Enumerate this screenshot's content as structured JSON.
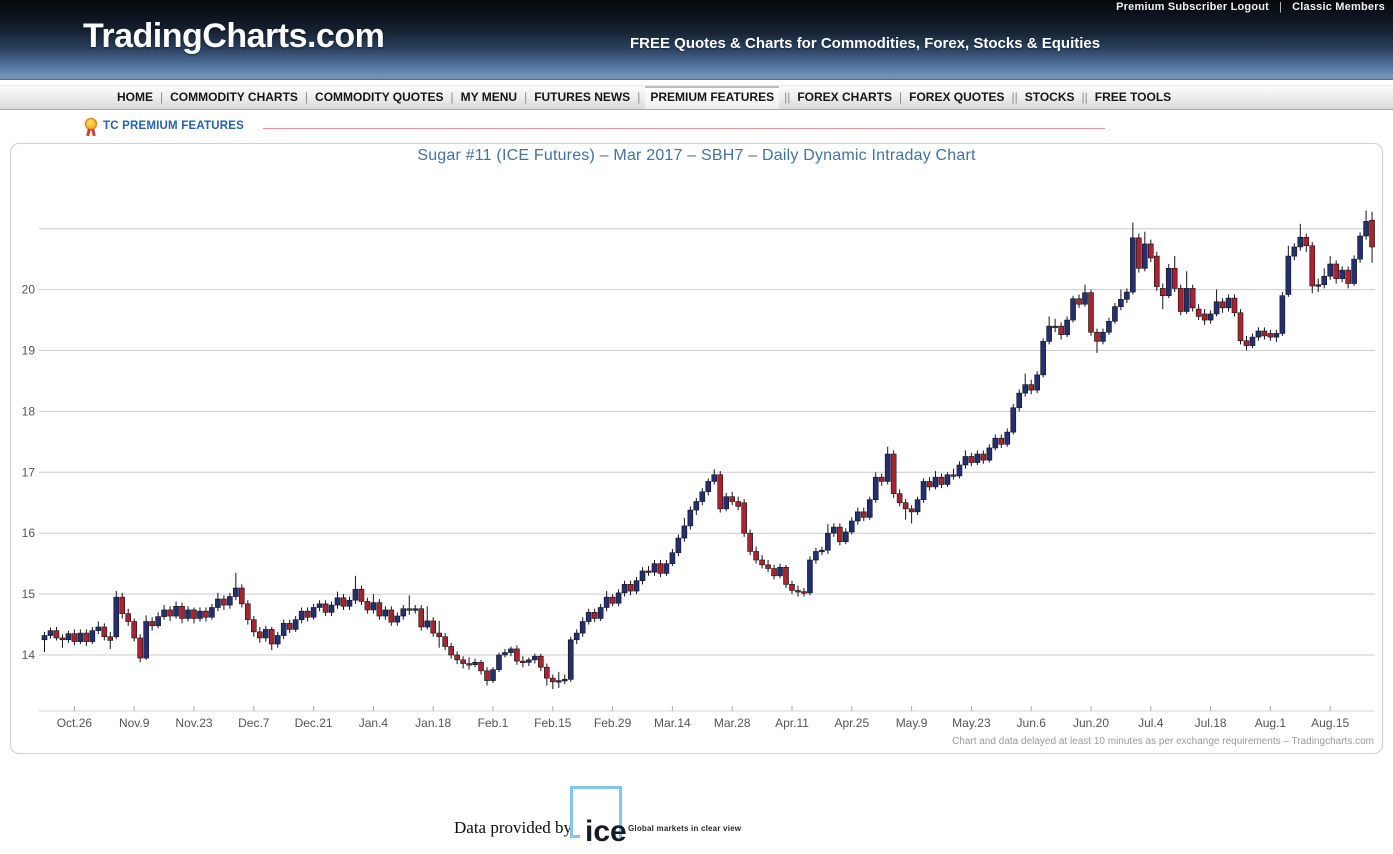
{
  "top_bar": {
    "links": [
      "Premium Subscriber Logout",
      "Classic Members"
    ],
    "separator": "|"
  },
  "header": {
    "logo": "TradingCharts.com",
    "tagline": "FREE Quotes & Charts for Commodities, Forex, Stocks & Equities"
  },
  "nav": {
    "items": [
      {
        "label": "HOME",
        "sep": "|",
        "active": false
      },
      {
        "label": "COMMODITY CHARTS",
        "sep": "|",
        "active": false
      },
      {
        "label": "COMMODITY QUOTES",
        "sep": "|",
        "active": false
      },
      {
        "label": "MY MENU",
        "sep": "|",
        "active": false
      },
      {
        "label": "FUTURES NEWS",
        "sep": "|",
        "active": false
      },
      {
        "label": "PREMIUM FEATURES",
        "sep": "||",
        "active": true
      },
      {
        "label": "FOREX CHARTS",
        "sep": "|",
        "active": false
      },
      {
        "label": "FOREX QUOTES",
        "sep": "||",
        "active": false
      },
      {
        "label": "STOCKS",
        "sep": "||",
        "active": false
      },
      {
        "label": "FREE TOOLS",
        "sep": "",
        "active": false
      }
    ]
  },
  "premium_row": {
    "icon": "medal-icon",
    "label": "TC PREMIUM FEATURES",
    "line_color": "#f08f9c"
  },
  "chart": {
    "title": "Sugar #11 (ICE Futures) – Mar 2017 – SBH7 – Daily Dynamic Intraday Chart",
    "disclaimer": "Chart and data delayed at least 10 minutes as per exchange requirements – Tradingcharts.com"
  },
  "chart_data": {
    "type": "candlestick",
    "title": "Sugar #11 (ICE Futures) – Mar 2017 – SBH7 – Daily Dynamic Intraday Chart",
    "ylim": [
      13.3,
      21.6
    ],
    "y_ticks": [
      14,
      15,
      16,
      17,
      18,
      19,
      20
    ],
    "gridline_prices": [
      14,
      15,
      16,
      17,
      18,
      19,
      20,
      21
    ],
    "grid_on": true,
    "x_tick_labels": [
      "Oct.26",
      "Nov.9",
      "Nov.23",
      "Dec.7",
      "Dec.21",
      "Jan.4",
      "Jan.18",
      "Feb.1",
      "Feb.15",
      "Feb.29",
      "Mar.14",
      "Mar.28",
      "Apr.11",
      "Apr.25",
      "May.9",
      "May.23",
      "Jun.6",
      "Jun.20",
      "Jul.4",
      "Jul.18",
      "Aug.1",
      "Aug.15"
    ],
    "x_tick_first_index": 5,
    "x_tick_step": 10,
    "colors": {
      "up": "#232f6f",
      "down": "#a8242f",
      "outline": "#14141c",
      "grid": "#cccccc",
      "axis_text": "#555555"
    },
    "candles": [
      [
        14.25,
        14.38,
        14.05,
        14.32
      ],
      [
        14.32,
        14.45,
        14.27,
        14.4
      ],
      [
        14.4,
        14.46,
        14.24,
        14.28
      ],
      [
        14.28,
        14.34,
        14.12,
        14.25
      ],
      [
        14.25,
        14.4,
        14.2,
        14.35
      ],
      [
        14.35,
        14.42,
        14.16,
        14.22
      ],
      [
        14.22,
        14.42,
        14.18,
        14.36
      ],
      [
        14.36,
        14.42,
        14.15,
        14.22
      ],
      [
        14.22,
        14.46,
        14.18,
        14.4
      ],
      [
        14.4,
        14.55,
        14.34,
        14.46
      ],
      [
        14.46,
        14.52,
        14.24,
        14.3
      ],
      [
        14.3,
        14.38,
        14.1,
        14.24
      ],
      [
        14.3,
        15.05,
        14.26,
        14.95
      ],
      [
        14.95,
        15.02,
        14.6,
        14.68
      ],
      [
        14.68,
        14.76,
        14.48,
        14.55
      ],
      [
        14.55,
        14.6,
        14.22,
        14.28
      ],
      [
        14.28,
        14.34,
        13.88,
        13.95
      ],
      [
        13.95,
        14.65,
        13.92,
        14.55
      ],
      [
        14.55,
        14.62,
        14.4,
        14.48
      ],
      [
        14.48,
        14.7,
        14.44,
        14.63
      ],
      [
        14.63,
        14.82,
        14.58,
        14.74
      ],
      [
        14.74,
        14.8,
        14.56,
        14.64
      ],
      [
        14.64,
        14.88,
        14.6,
        14.8
      ],
      [
        14.8,
        14.86,
        14.52,
        14.6
      ],
      [
        14.6,
        14.8,
        14.55,
        14.74
      ],
      [
        14.74,
        14.78,
        14.52,
        14.6
      ],
      [
        14.6,
        14.78,
        14.55,
        14.72
      ],
      [
        14.72,
        14.78,
        14.55,
        14.62
      ],
      [
        14.62,
        14.84,
        14.58,
        14.78
      ],
      [
        14.78,
        15.02,
        14.72,
        14.92
      ],
      [
        14.92,
        14.98,
        14.74,
        14.82
      ],
      [
        14.82,
        15.02,
        14.76,
        14.96
      ],
      [
        14.96,
        15.35,
        14.9,
        15.1
      ],
      [
        15.1,
        15.16,
        14.78,
        14.84
      ],
      [
        14.84,
        14.9,
        14.5,
        14.58
      ],
      [
        14.58,
        14.64,
        14.3,
        14.38
      ],
      [
        14.38,
        14.46,
        14.2,
        14.28
      ],
      [
        14.28,
        14.48,
        14.22,
        14.42
      ],
      [
        14.42,
        14.46,
        14.08,
        14.18
      ],
      [
        14.18,
        14.38,
        14.12,
        14.32
      ],
      [
        14.32,
        14.58,
        14.26,
        14.52
      ],
      [
        14.52,
        14.58,
        14.36,
        14.42
      ],
      [
        14.42,
        14.64,
        14.38,
        14.58
      ],
      [
        14.58,
        14.78,
        14.52,
        14.72
      ],
      [
        14.72,
        14.78,
        14.55,
        14.62
      ],
      [
        14.62,
        14.84,
        14.58,
        14.78
      ],
      [
        14.78,
        14.9,
        14.72,
        14.84
      ],
      [
        14.84,
        14.9,
        14.64,
        14.7
      ],
      [
        14.7,
        14.88,
        14.64,
        14.82
      ],
      [
        14.82,
        15.04,
        14.76,
        14.94
      ],
      [
        14.94,
        15.0,
        14.74,
        14.8
      ],
      [
        14.8,
        14.96,
        14.74,
        14.9
      ],
      [
        14.9,
        15.3,
        14.84,
        15.08
      ],
      [
        15.08,
        15.14,
        14.82,
        14.88
      ],
      [
        14.88,
        14.94,
        14.68,
        14.74
      ],
      [
        14.74,
        15.0,
        14.68,
        14.86
      ],
      [
        14.86,
        14.92,
        14.58,
        14.64
      ],
      [
        14.64,
        14.8,
        14.58,
        14.74
      ],
      [
        14.74,
        14.8,
        14.48,
        14.54
      ],
      [
        14.54,
        14.7,
        14.48,
        14.64
      ],
      [
        14.64,
        14.82,
        14.58,
        14.76
      ],
      [
        14.76,
        14.98,
        14.66,
        14.74
      ],
      [
        14.74,
        14.82,
        14.68,
        14.76
      ],
      [
        14.76,
        14.82,
        14.4,
        14.46
      ],
      [
        14.46,
        14.8,
        14.42,
        14.56
      ],
      [
        14.56,
        14.62,
        14.3,
        14.36
      ],
      [
        14.36,
        14.56,
        14.12,
        14.3
      ],
      [
        14.3,
        14.36,
        14.08,
        14.14
      ],
      [
        14.14,
        14.2,
        13.94,
        14.0
      ],
      [
        14.0,
        14.06,
        13.85,
        13.92
      ],
      [
        13.92,
        13.98,
        13.78,
        13.86
      ],
      [
        13.86,
        13.96,
        13.76,
        13.84
      ],
      [
        13.84,
        13.94,
        13.8,
        13.88
      ],
      [
        13.88,
        13.92,
        13.68,
        13.74
      ],
      [
        13.74,
        13.8,
        13.5,
        13.58
      ],
      [
        13.58,
        13.8,
        13.54,
        13.76
      ],
      [
        13.76,
        14.04,
        13.72,
        14.0
      ],
      [
        14.0,
        14.1,
        13.96,
        14.04
      ],
      [
        14.04,
        14.14,
        13.98,
        14.1
      ],
      [
        14.1,
        14.16,
        13.84,
        13.9
      ],
      [
        13.9,
        13.98,
        13.8,
        13.88
      ],
      [
        13.88,
        13.96,
        13.82,
        13.92
      ],
      [
        13.92,
        14.02,
        13.86,
        13.98
      ],
      [
        13.98,
        14.02,
        13.74,
        13.8
      ],
      [
        13.8,
        13.86,
        13.5,
        13.62
      ],
      [
        13.62,
        13.68,
        13.44,
        13.56
      ],
      [
        13.56,
        13.72,
        13.46,
        13.58
      ],
      [
        13.58,
        13.68,
        13.52,
        13.6
      ],
      [
        13.6,
        14.3,
        13.56,
        14.25
      ],
      [
        14.25,
        14.42,
        14.18,
        14.36
      ],
      [
        14.36,
        14.62,
        14.3,
        14.55
      ],
      [
        14.55,
        14.76,
        14.5,
        14.7
      ],
      [
        14.7,
        14.76,
        14.54,
        14.6
      ],
      [
        14.6,
        14.84,
        14.56,
        14.78
      ],
      [
        14.78,
        15.05,
        14.72,
        14.95
      ],
      [
        14.95,
        15.0,
        14.8,
        14.85
      ],
      [
        14.85,
        15.08,
        14.8,
        15.02
      ],
      [
        15.02,
        15.22,
        14.96,
        15.16
      ],
      [
        15.16,
        15.22,
        14.98,
        15.05
      ],
      [
        15.05,
        15.28,
        15.0,
        15.22
      ],
      [
        15.22,
        15.44,
        15.16,
        15.38
      ],
      [
        15.38,
        15.46,
        15.3,
        15.36
      ],
      [
        15.36,
        15.56,
        15.3,
        15.5
      ],
      [
        15.5,
        15.56,
        15.28,
        15.34
      ],
      [
        15.34,
        15.56,
        15.3,
        15.5
      ],
      [
        15.5,
        15.74,
        15.46,
        15.68
      ],
      [
        15.68,
        15.98,
        15.62,
        15.92
      ],
      [
        15.92,
        16.25,
        15.86,
        16.12
      ],
      [
        16.12,
        16.44,
        16.06,
        16.38
      ],
      [
        16.38,
        16.58,
        16.3,
        16.52
      ],
      [
        16.52,
        16.74,
        16.46,
        16.68
      ],
      [
        16.68,
        16.9,
        16.62,
        16.85
      ],
      [
        16.85,
        17.05,
        16.8,
        16.96
      ],
      [
        16.96,
        17.02,
        16.34,
        16.4
      ],
      [
        16.4,
        16.66,
        16.36,
        16.6
      ],
      [
        16.6,
        16.68,
        16.46,
        16.52
      ],
      [
        16.52,
        16.6,
        16.38,
        16.44
      ],
      [
        16.5,
        16.56,
        15.94,
        16.0
      ],
      [
        16.0,
        16.06,
        15.64,
        15.7
      ],
      [
        15.7,
        15.78,
        15.5,
        15.56
      ],
      [
        15.56,
        15.64,
        15.42,
        15.48
      ],
      [
        15.48,
        15.56,
        15.36,
        15.42
      ],
      [
        15.42,
        15.48,
        15.24,
        15.3
      ],
      [
        15.3,
        15.5,
        15.26,
        15.44
      ],
      [
        15.44,
        15.48,
        15.1,
        15.16
      ],
      [
        15.16,
        15.22,
        15.0,
        15.06
      ],
      [
        15.06,
        15.14,
        14.96,
        15.04
      ],
      [
        15.04,
        15.1,
        14.96,
        15.02
      ],
      [
        15.02,
        15.62,
        14.98,
        15.56
      ],
      [
        15.56,
        15.76,
        15.5,
        15.7
      ],
      [
        15.7,
        15.78,
        15.64,
        15.72
      ],
      [
        15.72,
        16.15,
        15.66,
        16.0
      ],
      [
        16.0,
        16.16,
        15.94,
        16.1
      ],
      [
        16.1,
        16.16,
        15.8,
        15.86
      ],
      [
        15.86,
        16.08,
        15.82,
        16.02
      ],
      [
        16.02,
        16.26,
        15.98,
        16.2
      ],
      [
        16.2,
        16.42,
        16.14,
        16.35
      ],
      [
        16.35,
        16.42,
        16.2,
        16.26
      ],
      [
        16.26,
        16.6,
        16.22,
        16.55
      ],
      [
        16.55,
        17.0,
        16.5,
        16.92
      ],
      [
        16.92,
        16.98,
        16.78,
        16.85
      ],
      [
        16.85,
        17.42,
        16.8,
        17.3
      ],
      [
        17.3,
        17.36,
        16.58,
        16.65
      ],
      [
        16.65,
        16.72,
        16.44,
        16.5
      ],
      [
        16.5,
        16.56,
        16.22,
        16.4
      ],
      [
        16.4,
        16.46,
        16.16,
        16.35
      ],
      [
        16.35,
        16.6,
        16.3,
        16.55
      ],
      [
        16.55,
        16.9,
        16.5,
        16.85
      ],
      [
        16.85,
        16.92,
        16.7,
        16.76
      ],
      [
        16.76,
        17.02,
        16.72,
        16.92
      ],
      [
        16.92,
        16.98,
        16.74,
        16.8
      ],
      [
        16.8,
        17.0,
        16.76,
        16.96
      ],
      [
        16.96,
        17.06,
        16.88,
        16.94
      ],
      [
        16.94,
        17.18,
        16.9,
        17.12
      ],
      [
        17.12,
        17.36,
        17.06,
        17.26
      ],
      [
        17.26,
        17.32,
        17.1,
        17.16
      ],
      [
        17.16,
        17.36,
        17.12,
        17.3
      ],
      [
        17.3,
        17.36,
        17.14,
        17.2
      ],
      [
        17.2,
        17.46,
        17.16,
        17.4
      ],
      [
        17.4,
        17.62,
        17.36,
        17.56
      ],
      [
        17.56,
        17.62,
        17.4,
        17.46
      ],
      [
        17.46,
        17.72,
        17.42,
        17.66
      ],
      [
        17.66,
        18.12,
        17.62,
        18.06
      ],
      [
        18.06,
        18.36,
        18.0,
        18.3
      ],
      [
        18.3,
        18.62,
        18.24,
        18.44
      ],
      [
        18.44,
        18.52,
        18.28,
        18.35
      ],
      [
        18.35,
        18.66,
        18.3,
        18.6
      ],
      [
        18.6,
        19.2,
        18.56,
        19.15
      ],
      [
        19.15,
        19.56,
        19.1,
        19.4
      ],
      [
        19.4,
        19.52,
        19.3,
        19.38
      ],
      [
        19.4,
        19.46,
        19.18,
        19.26
      ],
      [
        19.26,
        19.56,
        19.22,
        19.5
      ],
      [
        19.5,
        19.9,
        19.46,
        19.85
      ],
      [
        19.85,
        19.92,
        19.7,
        19.76
      ],
      [
        19.76,
        20.08,
        19.72,
        19.95
      ],
      [
        19.95,
        20.0,
        19.24,
        19.3
      ],
      [
        19.3,
        19.36,
        18.96,
        19.15
      ],
      [
        19.15,
        19.36,
        19.1,
        19.3
      ],
      [
        19.3,
        19.54,
        19.26,
        19.48
      ],
      [
        19.48,
        19.78,
        19.44,
        19.72
      ],
      [
        19.72,
        20.0,
        19.66,
        19.84
      ],
      [
        19.84,
        20.02,
        19.78,
        19.96
      ],
      [
        19.96,
        21.1,
        19.92,
        20.85
      ],
      [
        20.85,
        20.92,
        20.28,
        20.35
      ],
      [
        20.35,
        20.95,
        20.3,
        20.75
      ],
      [
        20.75,
        20.82,
        20.45,
        20.52
      ],
      [
        20.55,
        20.62,
        19.98,
        20.05
      ],
      [
        20.02,
        20.1,
        19.68,
        19.9
      ],
      [
        19.9,
        20.42,
        19.86,
        20.35
      ],
      [
        20.35,
        20.55,
        19.96,
        20.02
      ],
      [
        20.02,
        20.08,
        19.58,
        19.64
      ],
      [
        19.64,
        20.3,
        19.6,
        20.02
      ],
      [
        20.02,
        20.08,
        19.64,
        19.7
      ],
      [
        19.68,
        19.76,
        19.5,
        19.56
      ],
      [
        19.6,
        19.68,
        19.42,
        19.5
      ],
      [
        19.5,
        19.66,
        19.44,
        19.6
      ],
      [
        19.6,
        20.0,
        19.56,
        19.8
      ],
      [
        19.8,
        19.86,
        19.62,
        19.7
      ],
      [
        19.7,
        19.92,
        19.64,
        19.86
      ],
      [
        19.86,
        19.92,
        19.56,
        19.62
      ],
      [
        19.62,
        19.68,
        19.1,
        19.16
      ],
      [
        19.16,
        19.24,
        19.0,
        19.08
      ],
      [
        19.08,
        19.28,
        19.04,
        19.22
      ],
      [
        19.22,
        19.38,
        19.16,
        19.32
      ],
      [
        19.32,
        19.38,
        19.18,
        19.24
      ],
      [
        19.28,
        19.34,
        19.16,
        19.22
      ],
      [
        19.22,
        19.34,
        19.14,
        19.28
      ],
      [
        19.28,
        19.96,
        19.24,
        19.9
      ],
      [
        19.92,
        20.72,
        19.88,
        20.55
      ],
      [
        20.55,
        20.76,
        20.48,
        20.7
      ],
      [
        20.7,
        21.08,
        20.64,
        20.86
      ],
      [
        20.86,
        20.92,
        20.62,
        20.72
      ],
      [
        20.72,
        20.78,
        19.94,
        20.06
      ],
      [
        20.06,
        20.18,
        19.96,
        20.08
      ],
      [
        20.08,
        20.35,
        20.02,
        20.22
      ],
      [
        20.22,
        20.55,
        20.16,
        20.42
      ],
      [
        20.42,
        20.48,
        20.1,
        20.18
      ],
      [
        20.18,
        20.38,
        20.12,
        20.32
      ],
      [
        20.32,
        20.38,
        20.02,
        20.1
      ],
      [
        20.1,
        20.56,
        20.06,
        20.5
      ],
      [
        20.5,
        20.94,
        20.44,
        20.88
      ],
      [
        20.88,
        21.3,
        20.82,
        21.12
      ],
      [
        21.14,
        21.28,
        20.44,
        20.7
      ]
    ]
  },
  "footer": {
    "prefix": "Data provided by",
    "ice_logo_text": "ice",
    "ice_tagline": "Global markets in clear view",
    "ice_blue": "#85c6ec"
  }
}
